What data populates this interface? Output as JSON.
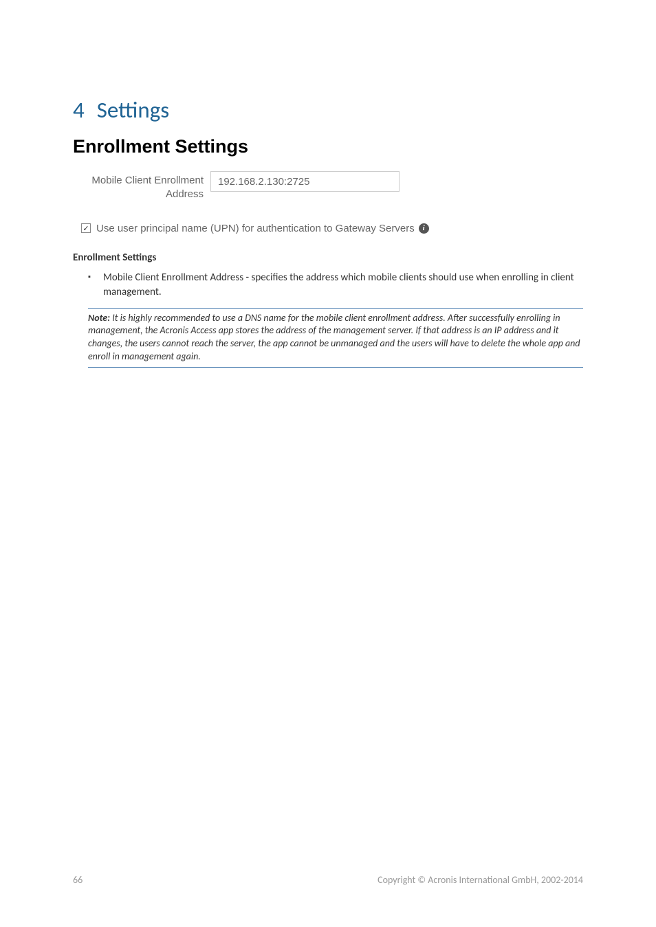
{
  "section": {
    "number": "4",
    "title": "Settings"
  },
  "form": {
    "title": "Enrollment Settings",
    "field_label": "Mobile Client Enrollment Address",
    "field_value": "192.168.2.130:2725"
  },
  "checkbox": {
    "label": "Use user principal name (UPN) for authentication to Gateway Servers",
    "checked": true
  },
  "content": {
    "subheading": "Enrollment Settings",
    "bullet_text": "Mobile Client Enrollment Address - specifies the address which mobile clients should use when enrolling in client management.",
    "note_label": "Note:",
    "note_text": " It is highly recommended to use a DNS name for the mobile client enrollment address. After successfully enrolling in management, the Acronis Access app stores the address of the management server. If that address is an IP address and it changes, the users cannot reach the server, the app cannot be unmanaged and the users will have to delete the whole app and enroll in management again."
  },
  "footer": {
    "page_number": "66",
    "copyright": "Copyright © Acronis International GmbH, 2002-2014"
  }
}
